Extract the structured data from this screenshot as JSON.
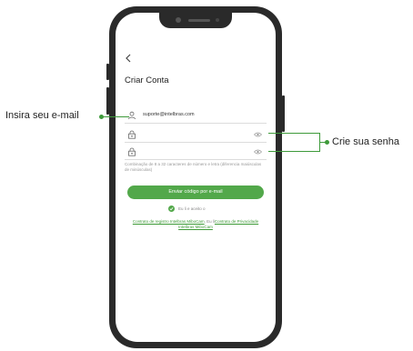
{
  "screen": {
    "back_icon": "chevron-left-icon",
    "title": "Criar Conta",
    "email_field": {
      "value": "suporte@intelbras.com",
      "icon": "user-icon"
    },
    "password_field": {
      "value": "",
      "icon": "lock-icon",
      "toggle_icon": "eye-icon"
    },
    "confirm_field": {
      "value": "",
      "icon": "lock-icon",
      "toggle_icon": "eye-icon"
    },
    "password_hint": "Combinação de 8 a 32 caracteres de número e letra (diferencia maiúsculas de minúsculas)",
    "submit_button": "Enviar código por e-mail",
    "agree_text": "Eu li e aceito o",
    "terms": {
      "link1": "Contrato de registro Intelbras MiboCam",
      "separator": ", Eu li",
      "link2": "Contrato de Privacidade Intelbras MiboCam"
    },
    "accent_color": "#52a84a"
  },
  "annotations": {
    "email_label": "Insira seu e-mail",
    "password_label": "Crie sua senha",
    "line_color": "#3e9a3a"
  }
}
